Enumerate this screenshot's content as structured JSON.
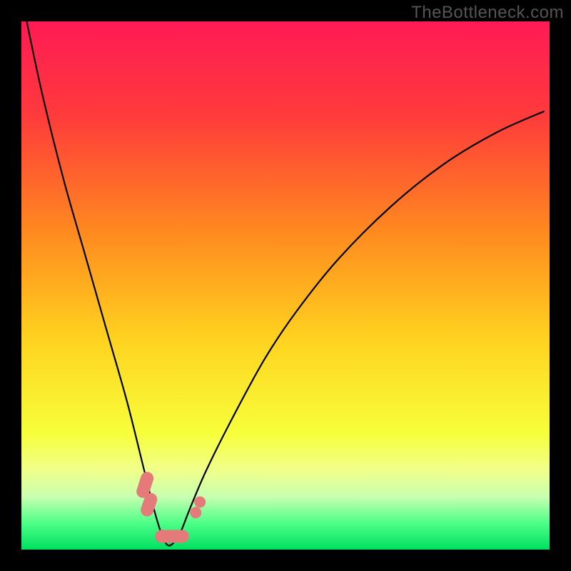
{
  "watermark": "TheBottleneck.com",
  "chart_data": {
    "type": "line",
    "title": "",
    "xlabel": "",
    "ylabel": "",
    "xlim": [
      0,
      100
    ],
    "ylim": [
      0,
      100
    ],
    "background_gradient": {
      "stops": [
        {
          "pos": 0,
          "color": "#ff1a55"
        },
        {
          "pos": 18,
          "color": "#ff3b3b"
        },
        {
          "pos": 40,
          "color": "#ff8a1f"
        },
        {
          "pos": 60,
          "color": "#ffd21f"
        },
        {
          "pos": 78,
          "color": "#f7ff3a"
        },
        {
          "pos": 85,
          "color": "#f0ff8a"
        },
        {
          "pos": 90,
          "color": "#c8ffb0"
        },
        {
          "pos": 95,
          "color": "#4dff88"
        },
        {
          "pos": 100,
          "color": "#00e060"
        }
      ]
    },
    "series": [
      {
        "name": "bottleneck-curve",
        "x": [
          1,
          4,
          8,
          12,
          16,
          20,
          23,
          25,
          26.5,
          27.5,
          28.5,
          30,
          32,
          35,
          40,
          46,
          52,
          60,
          70,
          80,
          90,
          99
        ],
        "y": [
          100,
          86,
          70,
          56,
          42,
          28,
          16,
          8,
          3,
          1,
          1,
          3,
          8,
          15,
          25,
          36,
          45,
          55,
          65,
          73,
          79,
          83
        ]
      }
    ],
    "markers": [
      {
        "kind": "capsule",
        "x1": 23.0,
        "y1": 11.0,
        "x2": 23.8,
        "y2": 13.5,
        "color": "#e47a7a"
      },
      {
        "kind": "capsule",
        "x1": 23.8,
        "y1": 7.5,
        "x2": 24.5,
        "y2": 9.5,
        "color": "#e47a7a"
      },
      {
        "kind": "capsule",
        "x1": 26.5,
        "y1": 2.5,
        "x2": 30.5,
        "y2": 2.5,
        "color": "#e47a7a"
      },
      {
        "kind": "dot",
        "x": 33.0,
        "y": 7.0,
        "color": "#e47a7a"
      },
      {
        "kind": "dot",
        "x": 33.8,
        "y": 9.0,
        "color": "#e47a7a"
      }
    ]
  }
}
